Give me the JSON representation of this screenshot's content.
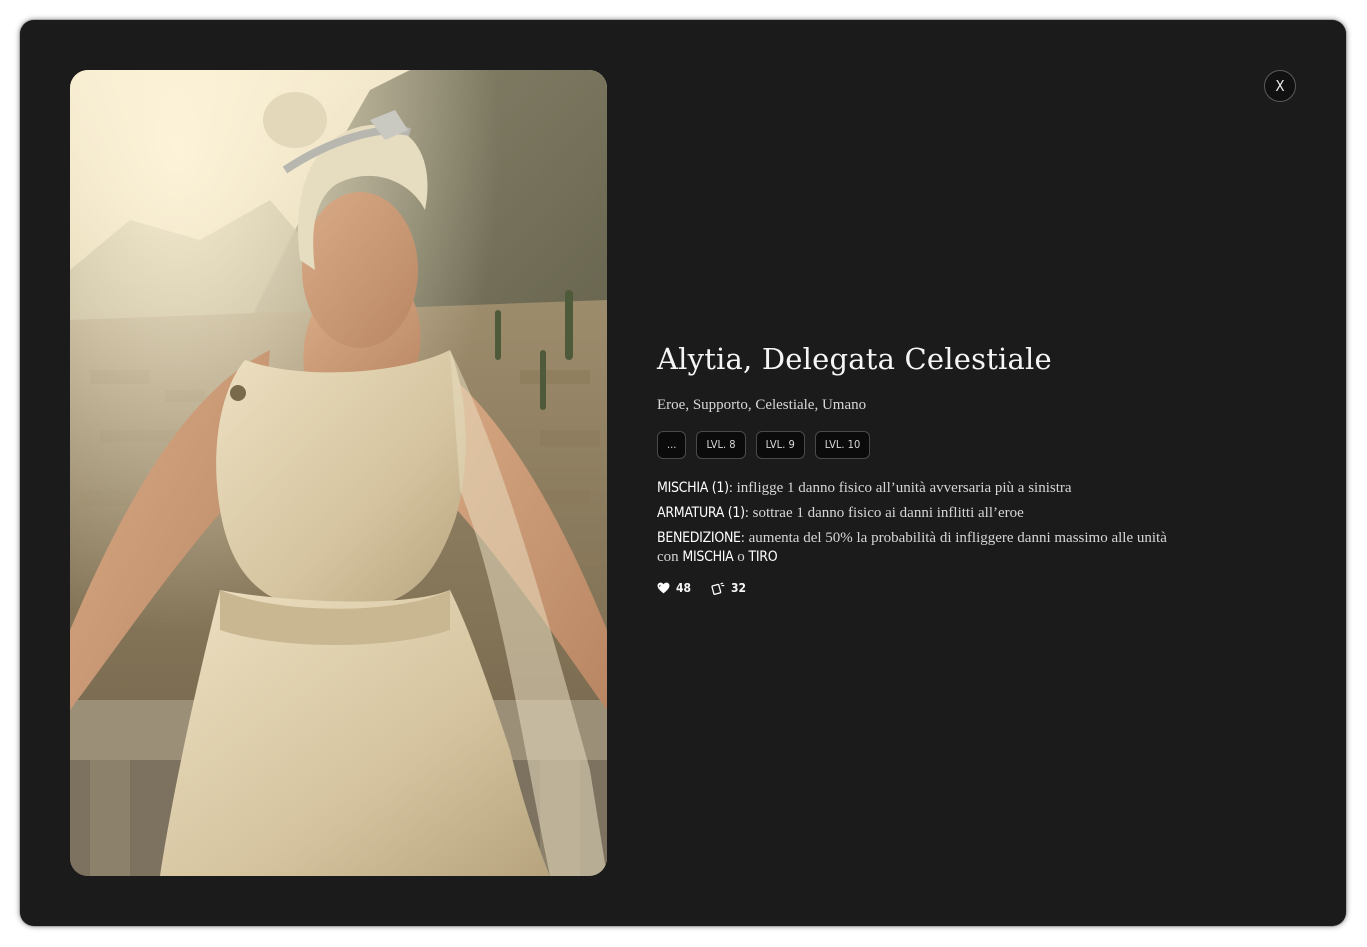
{
  "close_label": "X",
  "card": {
    "title": "Alytia, Delegata Celestiale",
    "tags": "Eroe, Supporto, Celestiale, Umano",
    "levels": [
      "...",
      "LVL. 8",
      "LVL. 9",
      "LVL. 10"
    ],
    "abilities": [
      {
        "keyword": "MISCHIA (1)",
        "text": ": infligge 1 danno fisico all’unità avversaria più a sinistra"
      },
      {
        "keyword": "ARMATURA (1)",
        "text": ": sottrae 1 danno fisico ai danni inflitti all’eroe"
      },
      {
        "keyword": "BENEDIZIONE",
        "text": ": aumenta del 50% la probabilità di infliggere danni massimo alle unità con ",
        "kw2": "MISCHIA",
        "conj": " o ",
        "kw3": "TIRO"
      }
    ],
    "stats": {
      "health": "48",
      "cards": "32"
    }
  },
  "icons": {
    "health": "heart-icon",
    "cards": "card-tilted-icon",
    "portrait": "hero-portrait-illustration"
  },
  "colors": {
    "modal_background": "#1b1b1b",
    "text": "#f5f5f5",
    "button_background": "#0b0b0b"
  }
}
